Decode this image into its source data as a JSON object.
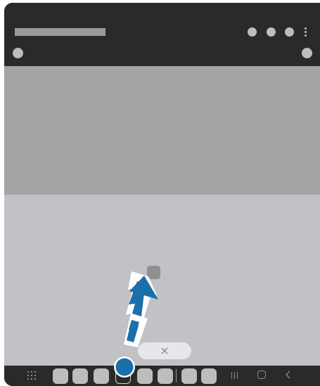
{
  "header": {
    "title_placeholder": "",
    "action_icons": [
      "status-dot-icon",
      "status-dot-icon",
      "status-dot-icon",
      "more-options-icon"
    ],
    "left_icon": "profile-dot-icon",
    "right_icon": "status-dot-icon"
  },
  "content": {
    "upper_panel": "",
    "lower_panel": ""
  },
  "overlay": {
    "close_label": "×",
    "gesture_icon": "upward-drag-arrow-icon",
    "touch_point_icon": "touch-point-icon"
  },
  "navigation": {
    "apps_icon": "apps-grid-icon",
    "dock_apps_count": 8,
    "recents_icon": "recent-apps-icon",
    "home_icon": "home-icon",
    "back_icon": "back-icon"
  },
  "colors": {
    "system_bar": "#2a2a2a",
    "upper_panel": "#a3a4a6",
    "lower_panel": "#c1c2c5",
    "arrow_blue": "#1b6faa",
    "close_pill": "#e7e7e9"
  }
}
